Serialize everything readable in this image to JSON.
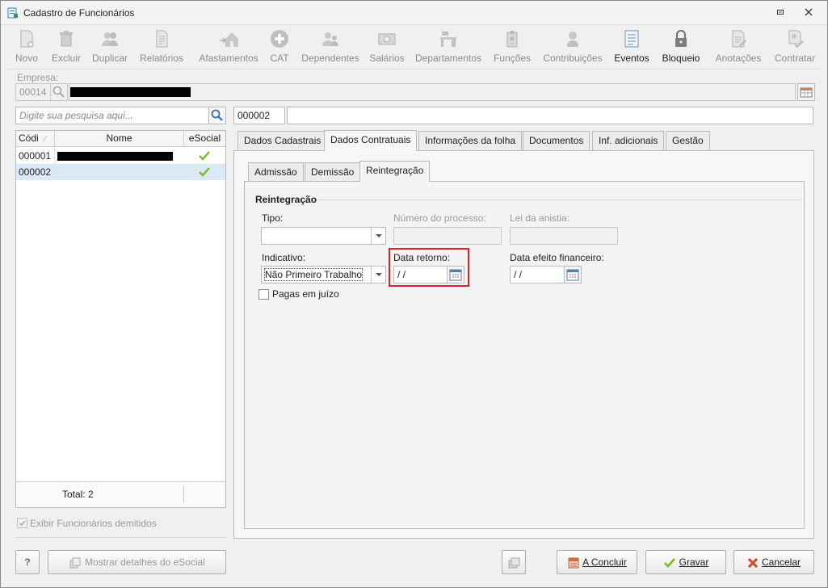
{
  "window": {
    "title": "Cadastro de Funcionários",
    "restore_icon": "restore-icon",
    "close_icon": "close-icon"
  },
  "toolbar": {
    "items": [
      {
        "label": "Novo",
        "icon": "new-document-icon"
      },
      {
        "label": "Excluir",
        "icon": "trash-icon"
      },
      {
        "label": "Duplicar",
        "icon": "users-icon"
      },
      {
        "label": "Relatórios",
        "icon": "report-icon"
      },
      {
        "label": "Afastamentos",
        "icon": "house-arrow-icon"
      },
      {
        "label": "CAT",
        "icon": "medical-cross-icon"
      },
      {
        "label": "Dependentes",
        "icon": "dependents-icon"
      },
      {
        "label": "Salários",
        "icon": "money-icon"
      },
      {
        "label": "Departamentos",
        "icon": "desk-icon"
      },
      {
        "label": "Funções",
        "icon": "badge-icon"
      },
      {
        "label": "Contribuições",
        "icon": "contribution-icon"
      },
      {
        "label": "Eventos",
        "icon": "list-icon"
      },
      {
        "label": "Bloqueio",
        "icon": "lock-icon"
      },
      {
        "label": "Anotações",
        "icon": "notes-icon"
      },
      {
        "label": "Contratar",
        "icon": "contract-icon"
      }
    ]
  },
  "empresa": {
    "label": "Empresa:",
    "code": "00014"
  },
  "search": {
    "placeholder": "Digite sua pesquisa aqui..."
  },
  "record": {
    "code": "000002",
    "name": ""
  },
  "employees": {
    "columns": [
      "Códi",
      "Nome",
      "eSocial"
    ],
    "rows": [
      {
        "code": "000001",
        "esocial": "ok"
      },
      {
        "code": "000002",
        "esocial": "ok"
      }
    ],
    "total": "Total: 2"
  },
  "show_dismissed": "Exibir Funcionários demitidos",
  "tabs": [
    "Dados Cadastrais",
    "Dados Contratuais",
    "Informações da folha",
    "Documentos",
    "Inf. adicionais",
    "Gestão"
  ],
  "subtabs": [
    "Admissão",
    "Demissão",
    "Reintegração"
  ],
  "reintegracao": {
    "section": "Reintegração",
    "tipo_label": "Tipo:",
    "tipo_value": "",
    "processo_label": "Número do processo:",
    "lei_label": "Lei da anistia:",
    "indicativo_label": "Indicativo:",
    "indicativo_value": "Não Primeiro Trabalho",
    "data_retorno_label": "Data retorno:",
    "data_retorno_value": " /  /",
    "data_efeito_label": "Data efeito financeiro:",
    "data_efeito_value": " /  /",
    "pagas_juizo": "Pagas em juízo"
  },
  "footer": {
    "help": "?",
    "esocial_details": "Mostrar detalhes do eSocial",
    "concluir": "A Concluir",
    "gravar": "Gravar",
    "cancelar": "Cancelar"
  },
  "colors": {
    "highlight": "#e0202a",
    "selected_row": "#dbe8f6",
    "check": "#7ab828"
  }
}
